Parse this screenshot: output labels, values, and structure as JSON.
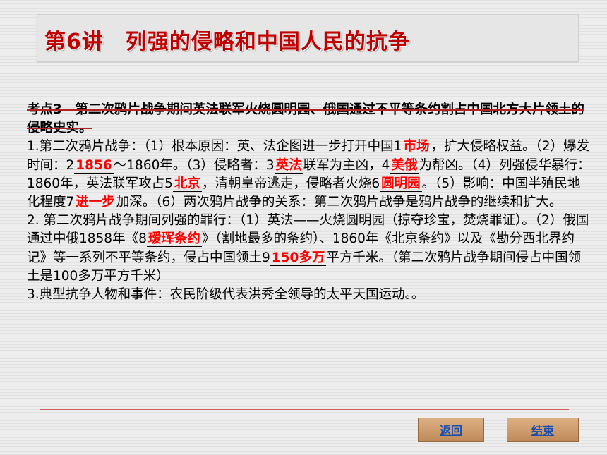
{
  "title": "第6讲　列强的侵略和中国人民的抗争",
  "section_heading": "考点3　第二次鸦片战争期间英法联军火烧圆明园、俄国通过不平等条约割占中国北方大片领土的侵略史实。",
  "p1": {
    "a": "1.第二次鸦片战争：（1）根本原因：英、法企图进一步打开中国1",
    "b1": "市场",
    "c": "，扩大侵略权益。（2）爆发时间：2",
    "b2": "1856",
    "d": "～1860年。（3）侵略者：3",
    "b3": "英法",
    "e": "联军为主凶，4",
    "b4": "美俄",
    "f": "为帮凶。（4）列强侵华暴行：1860年，英法联军攻占5",
    "b5": "北京",
    "g": "，清朝皇帝逃走，侵略者火烧6",
    "b6": "圆明园",
    "h": "。（5）影响：中国半殖民地化程度7",
    "b7": "进一步",
    "i": "加深。（6）两次鸦片战争的关系：第二次鸦片战争是鸦片战争的继续和扩大。"
  },
  "p2": {
    "a": "2. 第二次鸦片战争期间列强的罪行：（1）英法——火烧圆明园（掠夺珍宝，焚烧罪证）。（2）俄国通过中俄1858年《8",
    "b8": "瑷珲条约",
    "c": "》（割地最多的条约）、1860年《北京条约》以及《勘分西北界约记》等一系列不平等条约，侵占中国领土9",
    "b9": "150多万",
    "d": "平方千米。（第二次鸦片战争期间侵占中国领土是100多万平方千米）"
  },
  "p3": "3.典型抗争人物和事件：农民阶级代表洪秀全领导的太平天国运动。。",
  "nav": {
    "back": "返回",
    "end": "结束"
  }
}
